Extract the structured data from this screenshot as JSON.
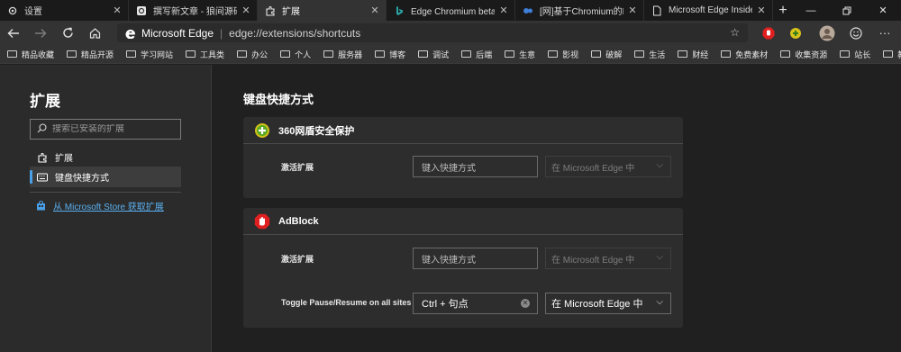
{
  "tabs": [
    {
      "title": "设置",
      "icon": "gear-icon"
    },
    {
      "title": "撰写新文章 - 狼间源码 - F",
      "icon": "blog-icon"
    },
    {
      "title": "扩展",
      "icon": "extension-icon"
    },
    {
      "title": "Edge Chromium beta新特",
      "icon": "bing-icon"
    },
    {
      "title": "[网]基于Chromium的Edg",
      "icon": "blog-icon"
    },
    {
      "title": "Microsoft Edge Insider",
      "icon": "page-icon"
    }
  ],
  "toolbar": {
    "brand": "Microsoft Edge",
    "separator": "|",
    "url": "edge://extensions/shortcuts"
  },
  "bookmarks": [
    "精品收藏",
    "精品开源",
    "学习网站",
    "工具类",
    "办公",
    "个人",
    "服务器",
    "博客",
    "调试",
    "后端",
    "生意",
    "影视",
    "破解",
    "生活",
    "财经",
    "免费素材",
    "收集资源",
    "站长",
    "教程"
  ],
  "sidebar": {
    "title": "扩展",
    "search_placeholder": "搜索已安装的扩展",
    "items": [
      {
        "label": "扩展"
      },
      {
        "label": "键盘快捷方式"
      }
    ],
    "store_link": "从 Microsoft Store 获取扩展"
  },
  "main": {
    "title": "键盘快捷方式",
    "extensions": [
      {
        "name": "360网盾安全保护",
        "rows": [
          {
            "label": "激活扩展",
            "shortcut": "",
            "placeholder": "键入快捷方式",
            "scope": "在 Microsoft Edge 中"
          }
        ]
      },
      {
        "name": "AdBlock",
        "rows": [
          {
            "label": "激活扩展",
            "shortcut": "",
            "placeholder": "键入快捷方式",
            "scope": "在 Microsoft Edge 中"
          },
          {
            "label": "Toggle Pause/Resume on all sites",
            "shortcut": "Ctrl + 句点",
            "placeholder": "",
            "scope": "在 Microsoft Edge 中"
          }
        ]
      }
    ]
  },
  "colors": {
    "accent": "#4aa0e6",
    "link": "#5ab0f0",
    "background": "#202020",
    "card": "#2d2d2d"
  }
}
